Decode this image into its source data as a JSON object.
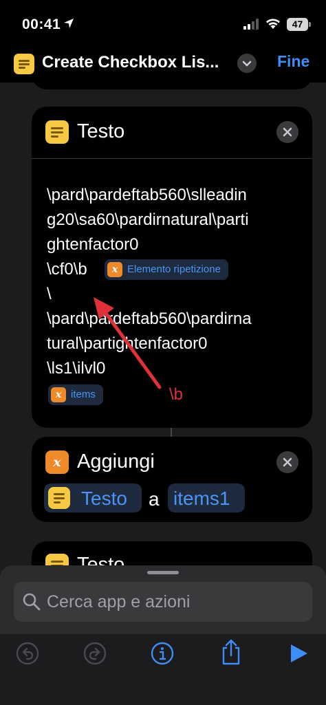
{
  "status": {
    "time": "00:41",
    "battery": "47"
  },
  "nav": {
    "title": "Create Checkbox Lis...",
    "done": "Fine"
  },
  "testo_card": {
    "title": "Testo",
    "lines": [
      "\\pard\\pardeftab560\\slleadin",
      "g20\\sa60\\pardirnatural\\parti",
      "ghtenfactor0",
      "\\cf0\\b",
      "\\",
      "\\pard\\pardeftab560\\pardirna",
      "tural\\partightenfactor0",
      "\\ls1\\ilvl0"
    ],
    "variable_chip": "Elemento ripetizione",
    "items_chip": "items"
  },
  "annotation": {
    "text": "\\b",
    "color": "#e0303a"
  },
  "add_card": {
    "title": "Aggiungi",
    "token_text": "Testo",
    "connector": "a",
    "token_var": "items1"
  },
  "testo_card2": {
    "title": "Testo"
  },
  "search": {
    "placeholder": "Cerca app e azioni"
  },
  "icons": [
    "location-arrow-icon",
    "signal-icon",
    "wifi-icon",
    "battery-icon",
    "text-action-icon",
    "chevron-down-icon",
    "close-icon",
    "variable-icon",
    "search-icon",
    "undo-icon",
    "redo-icon",
    "info-icon",
    "share-icon",
    "play-icon"
  ],
  "colors": {
    "accent": "#3d8ef7",
    "text_tile": "#f7c843",
    "variable_tile": "#ef8a2a",
    "annotation": "#e0303a"
  }
}
